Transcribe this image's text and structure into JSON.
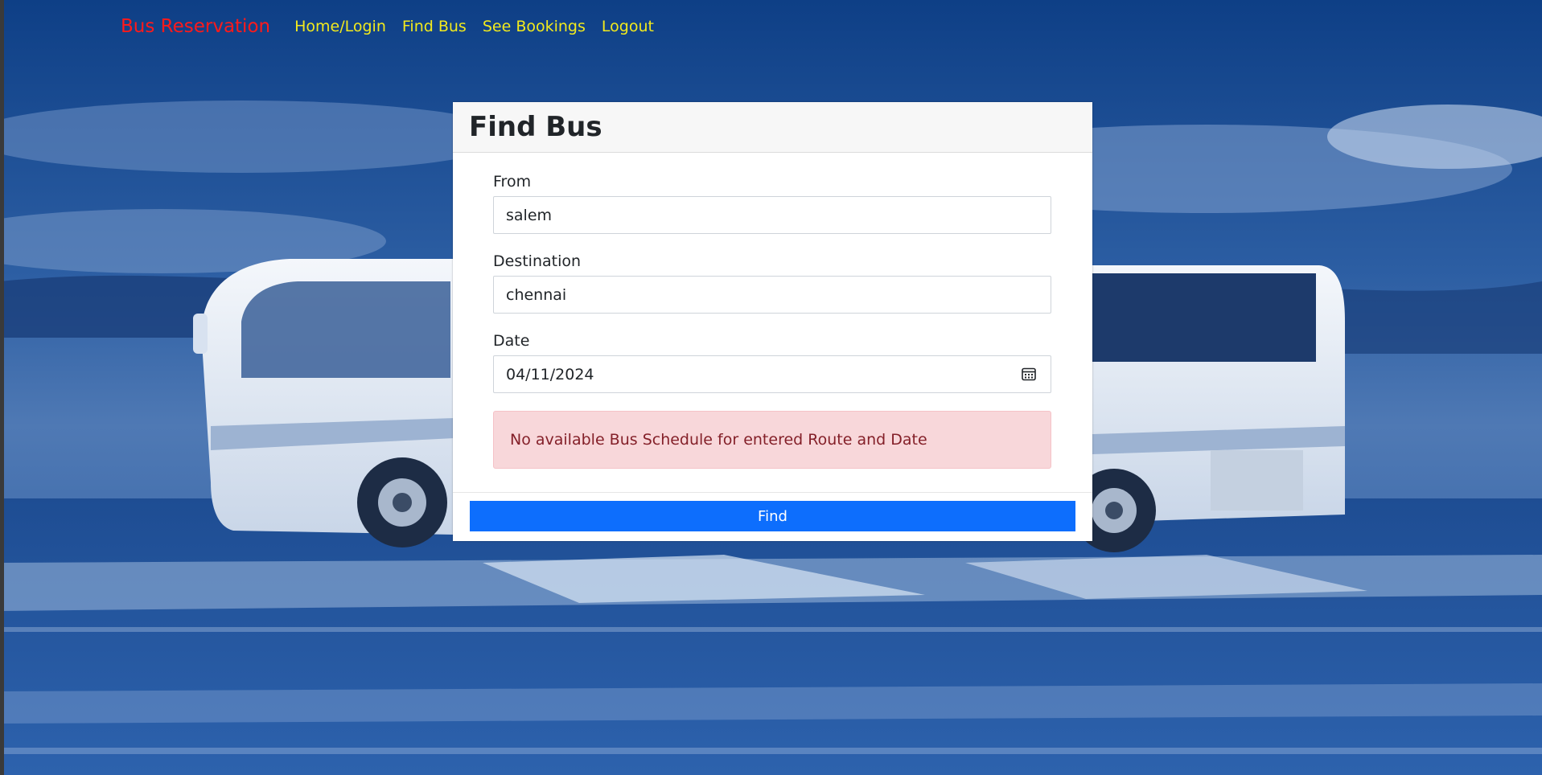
{
  "navbar": {
    "brand": "Bus Reservation",
    "links": [
      "Home/Login",
      "Find Bus",
      "See Bookings",
      "Logout"
    ]
  },
  "card": {
    "title": "Find Bus",
    "from": {
      "label": "From",
      "value": "salem"
    },
    "destination": {
      "label": "Destination",
      "value": "chennai"
    },
    "date": {
      "label": "Date",
      "value": "04/11/2024",
      "icon": "calendar-icon"
    },
    "alert": "No available Bus Schedule for entered Route and Date",
    "find_label": "Find"
  },
  "colors": {
    "brand": "#ff1a1a",
    "nav_link": "#f2ea1d",
    "primary_button": "#0d6efd",
    "alert_bg": "#f8d7da",
    "alert_text": "#842029"
  }
}
